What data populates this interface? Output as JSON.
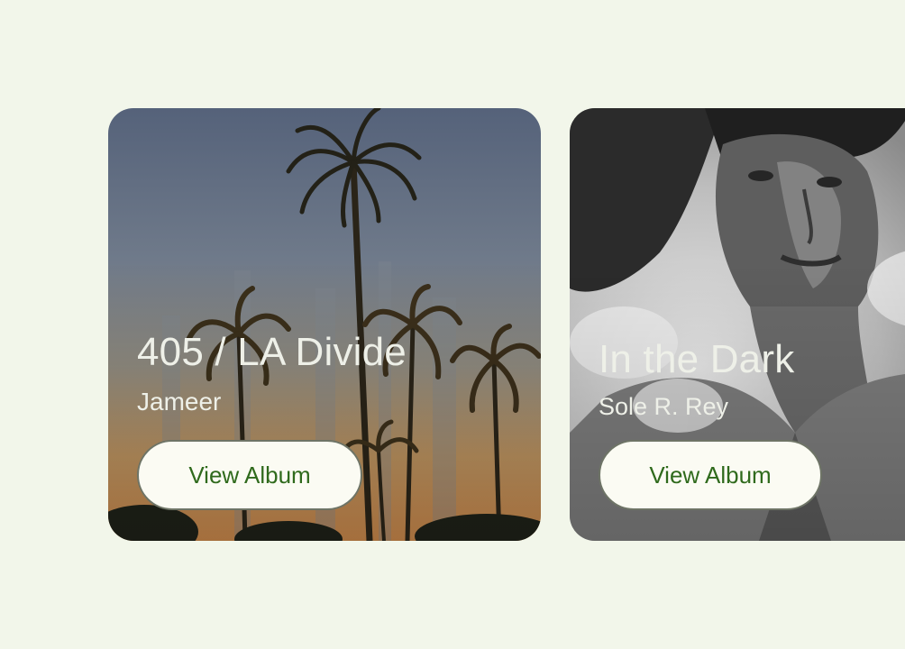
{
  "albums": [
    {
      "title": "405 / LA Divide",
      "artist": "Jameer",
      "button_label": "View Album",
      "artwork": "palm-trees-sunset-image"
    },
    {
      "title": "In the Dark",
      "artist": "Sole R. Rey",
      "button_label": "View Album",
      "artwork": "monochrome-portrait-image"
    }
  ],
  "colors": {
    "background": "#f2f6ea",
    "button_bg": "#fbfbf3",
    "button_text": "#2f6a1c",
    "button_border": "#6e7466",
    "card_text": "#eef0e8"
  }
}
